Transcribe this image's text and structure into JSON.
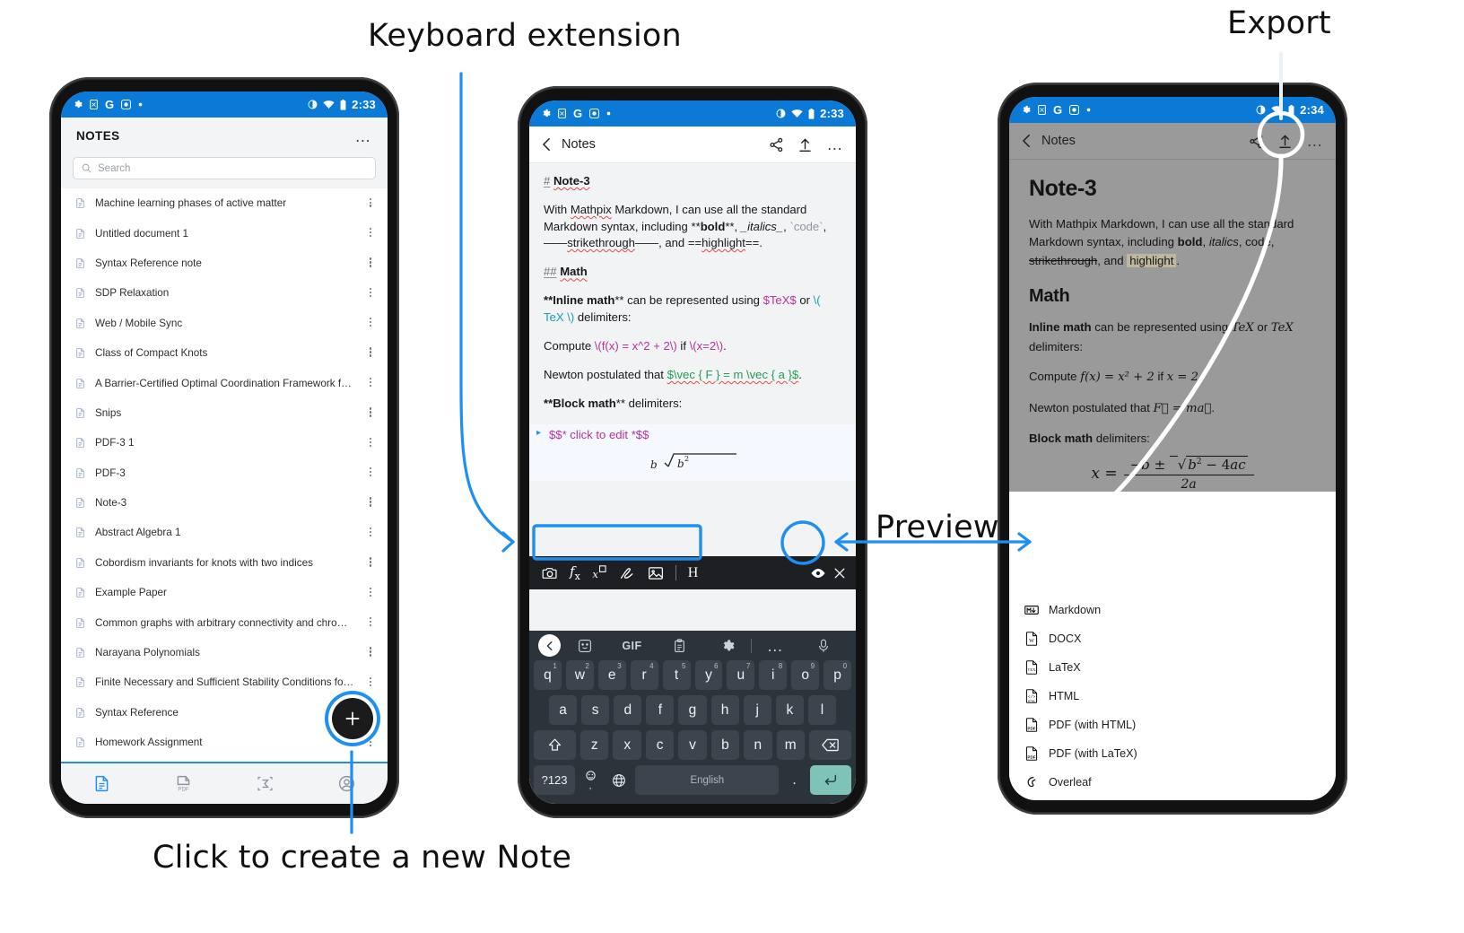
{
  "annotations": [
    {
      "id": "keyboard",
      "label": "Keyboard extension"
    },
    {
      "id": "export",
      "label": "Export"
    },
    {
      "id": "preview",
      "label": "Preview"
    },
    {
      "id": "newnote",
      "label": "Click to create a new Note"
    }
  ],
  "colors": {
    "accent_blue": "#1f8ff0",
    "status_bar_blue": "#0b7ad6",
    "preview_dim": "#9a9a9a",
    "keyboard_bg": "#2b333b",
    "key_bg": "#3c454e",
    "enter_key": "#7ec2b8",
    "highlight_tan": "#bdb79d",
    "token_magenta": "#b3359c",
    "token_teal": "#15a0b8",
    "token_green": "#1f9d55"
  },
  "phone1": {
    "statusbar": {
      "icons": [
        "gear-icon",
        "sim-icon",
        "google-icon",
        "record-icon",
        "dot-icon"
      ],
      "right_icons": [
        "contrast-icon",
        "wifi-icon",
        "battery-icon"
      ],
      "time": "2:33"
    },
    "header": {
      "title": "NOTES",
      "overflow": "…"
    },
    "search": {
      "placeholder": "Search",
      "value": ""
    },
    "notes": [
      "Machine learning phases of active matter",
      "Untitled document 1",
      "Syntax Reference note",
      "SDP Relaxation",
      "Web / Mobile Sync",
      "Class of Compact Knots",
      "A Barrier-Certified Optimal Coordination Framework f…",
      "Snips",
      "PDF-3 1",
      "PDF-3",
      "Note-3",
      "Abstract Algebra 1",
      "Cobordism invariants for knots with two indices",
      "Example Paper",
      "Common graphs with arbitrary connectivity and chro…",
      "Narayana Polynomials",
      "Finite Necessary and Sufficient Stability Conditions fo…",
      "Syntax Reference",
      "Homework Assignment"
    ],
    "fab": {
      "label": "+"
    },
    "bottom_nav": [
      {
        "name": "notes-tab",
        "icon": "document-icon",
        "active": true
      },
      {
        "name": "pdf-tab",
        "icon": "pdf-icon",
        "active": false
      },
      {
        "name": "snips-tab",
        "icon": "sigma-icon",
        "active": false
      },
      {
        "name": "account-tab",
        "icon": "account-icon",
        "active": false
      }
    ]
  },
  "phone2": {
    "statusbar": {
      "time": "2:33"
    },
    "header": {
      "back_label": "Notes",
      "actions": [
        "share-icon",
        "export-icon",
        "overflow-icon"
      ]
    },
    "editor": {
      "line_heading": {
        "hash": "#",
        "text": "Note-3"
      },
      "para1": {
        "t1": "With ",
        "mathpix": "Mathpix",
        "t2": " Markdown, I can use all the standard Markdown syntax, including ",
        "bold_token": "**",
        "bold_word": "bold",
        "bold_token2": "**",
        "t3": ", ",
        "ital_token": "_",
        "ital_word": "italics",
        "ital_token2": "_",
        "t4": ", ",
        "code_token": "`",
        "code_word": "code",
        "code_token2": "`",
        "t5": ", ",
        "strike_token": "——",
        "strike_word": "strikethrough",
        "strike_token2": "——",
        "t6": ", and ",
        "hl_token": "==",
        "hl_word": "highlight",
        "hl_token2": "==",
        "t7": "."
      },
      "line_math_heading": {
        "hash": "##",
        "text": "Math"
      },
      "para2_a": "**",
      "para2_b": "Inline math",
      "para2_c": "** can be represented using ",
      "para2_tex1": "$TeX$",
      "para2_d": " or ",
      "para2_tex2": "\\( TeX \\)",
      "para2_e": " delimiters:",
      "para3_a": "Compute ",
      "para3_t1": "\\(f(x) = x^2 + 2\\)",
      "para3_b": " if ",
      "para3_t2": "\\(x=2\\)",
      "para3_c": ".",
      "para4_a": "Newton postulated that ",
      "para4_t": "$\\vec { F } = m \\vec { a }$",
      "para4_b": ".",
      "para5_a": "**",
      "para5_b": "Block math",
      "para5_c": "** delimiters:",
      "block_line": "$$* click to edit *$$"
    },
    "keyboard_extension": {
      "tools": [
        "camera-icon",
        "fx-icon",
        "snip-superscript-icon",
        "draw-icon",
        "image-icon",
        "divider",
        "H"
      ],
      "preview_button": "eye-icon",
      "close_button": "close-icon"
    },
    "gboard": {
      "toolbar": [
        "chevron-left-icon",
        "sticker-icon",
        "GIF",
        "clipboard-icon",
        "gear-icon",
        "divider",
        "overflow-icon",
        "mic-icon"
      ],
      "row1": [
        {
          "k": "q",
          "n": "1"
        },
        {
          "k": "w",
          "n": "2"
        },
        {
          "k": "e",
          "n": "3"
        },
        {
          "k": "r",
          "n": "4"
        },
        {
          "k": "t",
          "n": "5"
        },
        {
          "k": "y",
          "n": "6"
        },
        {
          "k": "u",
          "n": "7"
        },
        {
          "k": "i",
          "n": "8"
        },
        {
          "k": "o",
          "n": "9"
        },
        {
          "k": "p",
          "n": "0"
        }
      ],
      "row2": [
        "a",
        "s",
        "d",
        "f",
        "g",
        "h",
        "j",
        "k",
        "l"
      ],
      "row3": [
        "shift-icon",
        "z",
        "x",
        "c",
        "v",
        "b",
        "n",
        "m",
        "backspace-icon"
      ],
      "row4": {
        "sym": "?123",
        "emoji": "emoji-comma-icon",
        "globe": "globe-icon",
        "space": "English",
        "period": ".",
        "enter": "enter-icon"
      }
    }
  },
  "phone3": {
    "statusbar": {
      "time": "2:34"
    },
    "header": {
      "back_label": "Notes",
      "actions": [
        "share-icon",
        "export-icon",
        "overflow-icon"
      ]
    },
    "preview": {
      "h1": "Note-3",
      "p1_a": "With Mathpix Markdown, I can use all the standard Markdown syntax, including ",
      "p1_bold": "bold",
      "p1_b": ", ",
      "p1_ital": "italics",
      "p1_c": ", code, ",
      "p1_strike": "strikethrough",
      "p1_d": ", and ",
      "p1_hl": "highlight",
      "p1_e": ".",
      "h2": "Math",
      "p2_bold": "Inline math",
      "p2_a": " can be represented using ",
      "p2_tex": "TeX",
      "p2_b": " or ",
      "p2_tex2": "TeX",
      "p2_c": " delimiters:",
      "p3_a": "Compute ",
      "p3_m1": "f(x) = x² + 2",
      "p3_b": " if ",
      "p3_m2": "x = 2",
      "p3_c": ".",
      "p4_a": "Newton postulated that ",
      "p4_m": "F⃗ = ma⃗",
      "p4_b": ".",
      "p5_bold": "Block math",
      "p5_a": " delimiters:",
      "quadratic": {
        "lhs": "x =",
        "num": "−b ± √(b² − 4ac)",
        "den": "2a"
      }
    },
    "export_menu": [
      {
        "label": "Markdown",
        "icon": "markdown-icon"
      },
      {
        "label": "DOCX",
        "icon": "docx-icon"
      },
      {
        "label": "LaTeX",
        "icon": "latex-icon"
      },
      {
        "label": "HTML",
        "icon": "html-icon"
      },
      {
        "label": "PDF (with HTML)",
        "icon": "pdf-icon"
      },
      {
        "label": "PDF (with LaTeX)",
        "icon": "pdf-icon"
      },
      {
        "label": "Overleaf",
        "icon": "overleaf-icon"
      }
    ]
  }
}
